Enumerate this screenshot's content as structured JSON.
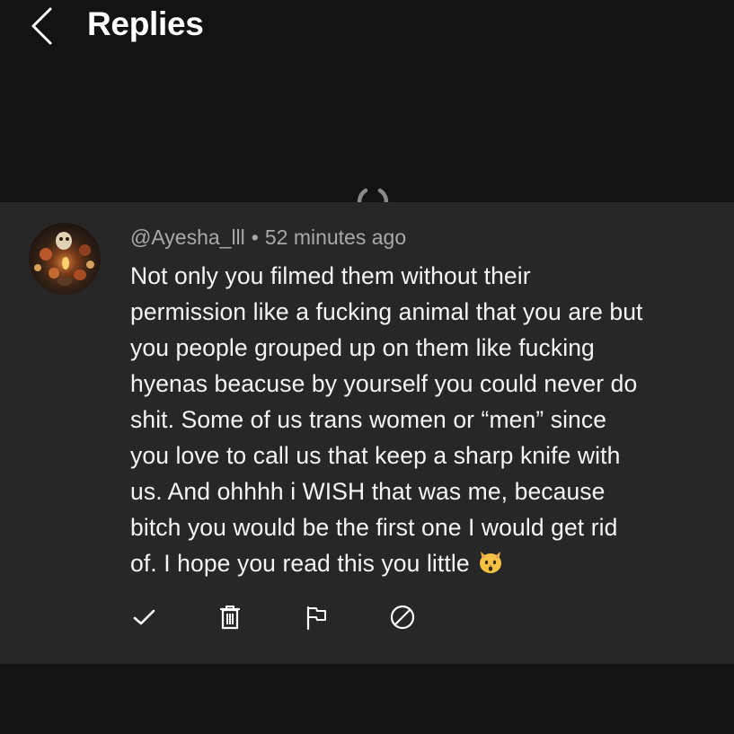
{
  "header": {
    "title": "Replies",
    "back_icon": "chevron-left-icon"
  },
  "comment": {
    "author": "@Ayesha_lll",
    "separator": "•",
    "time": "52 minutes ago",
    "lines": [
      "Not only you filmed them without their",
      "permission like a fucking animal that you are but",
      "you people grouped up on them like fucking",
      "hyenas beacuse by yourself you could never do",
      "shit. Some of us trans women or “men” since",
      "you love to call us that keep a sharp knife with",
      "us. And ohhhh i WISH that was me, because",
      "bitch you would be the first one I would get rid",
      "of. I hope you read this you little"
    ],
    "trailing_emoji": "cat-emoji"
  },
  "actions": {
    "approve_icon": "checkmark-icon",
    "delete_icon": "trash-icon",
    "report_icon": "flag-icon",
    "block_icon": "block-icon"
  },
  "colors": {
    "background": "#131313",
    "card": "#272727",
    "text": "#f4f4f4",
    "meta": "#a9a9a9"
  }
}
